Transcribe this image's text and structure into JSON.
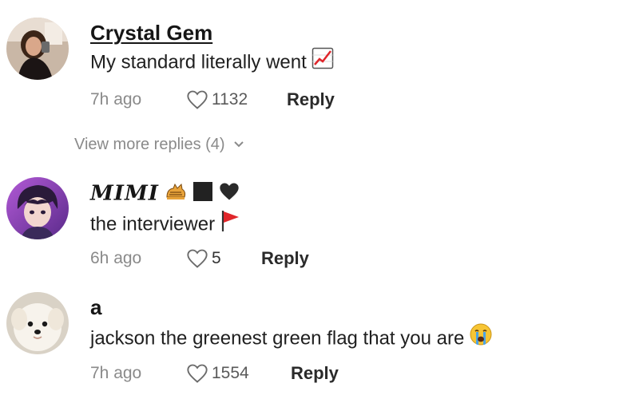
{
  "comments": [
    {
      "username": "Crystal Gem",
      "text": "My standard literally went",
      "text_emoji": "chart-increasing-icon",
      "time": "7h ago",
      "likes": "1132",
      "reply_label": "Reply"
    },
    {
      "username": "MIMI",
      "username_emojis": [
        "cat-icon",
        "black-square-icon",
        "black-heart-icon"
      ],
      "text": "the interviewer",
      "text_emoji": "red-flag-icon",
      "time": "6h ago",
      "likes": "5",
      "reply_label": "Reply"
    },
    {
      "username": "a",
      "text": "jackson the greenest green flag that you are",
      "text_emoji": "crying-face-icon",
      "time": "7h ago",
      "likes": "1554",
      "reply_label": "Reply"
    }
  ],
  "view_more_replies": "View more replies (4)",
  "colors": {
    "text": "#1f1f1f",
    "muted": "#8a8a8a",
    "flag_red": "#e0262b"
  }
}
